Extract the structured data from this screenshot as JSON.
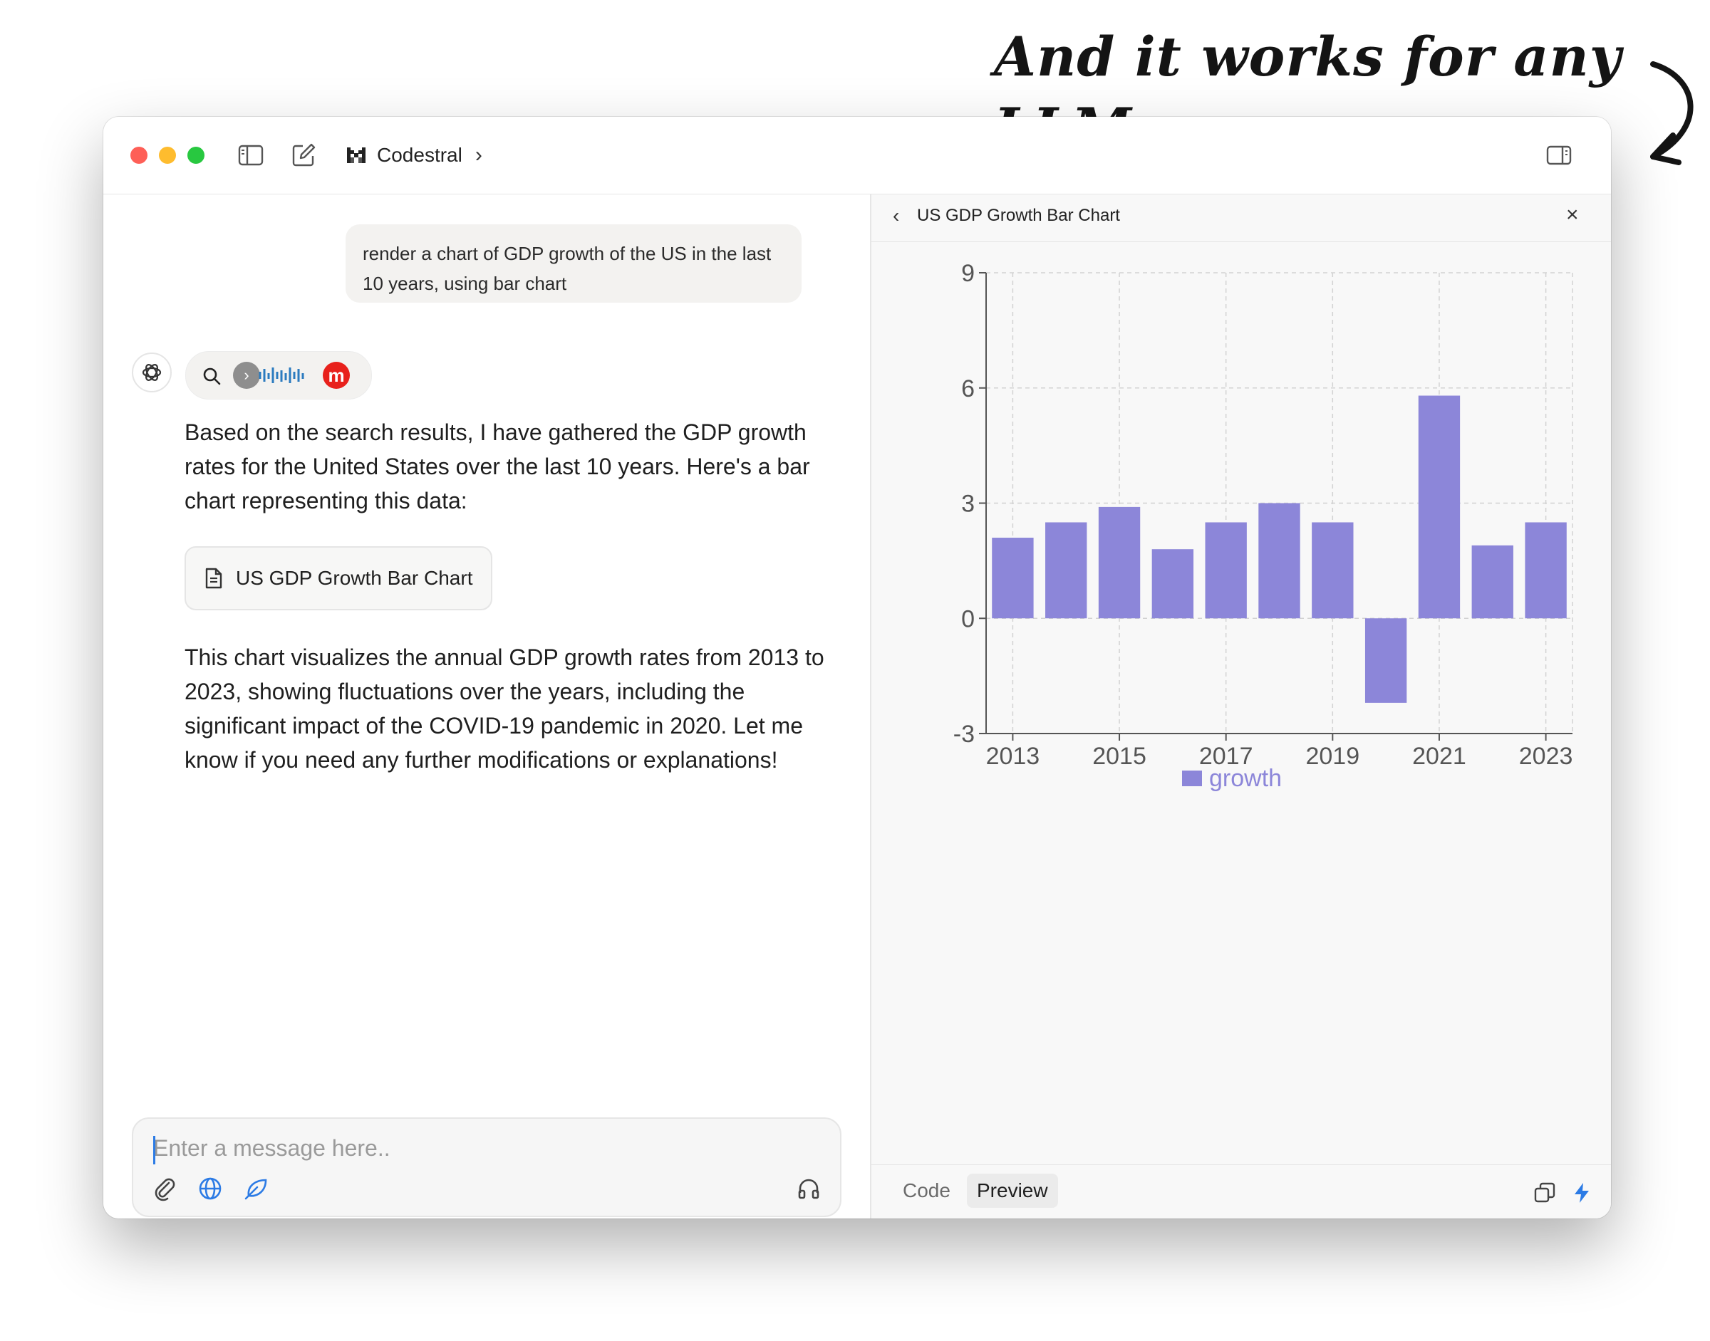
{
  "annotation": {
    "text": "And it works for any LLM"
  },
  "titlebar": {
    "model_name": "Codestral",
    "chevron": "›"
  },
  "chat": {
    "user_message": "render a chart of GDP growth of the US in the last 10 years, using bar chart",
    "assistant_intro": "Based on the search results, I have gathered the GDP growth rates for the United States over the last 10 years. Here's a bar chart representing this data:",
    "artifact_card_label": "US GDP Growth Bar Chart",
    "assistant_outro": "This chart visualizes the annual GDP growth rates from 2013 to 2023, showing fluctuations over the years, including the significant impact of the COVID-19 pandemic in 2020. Let me know if you need any further modifications or explanations!",
    "search_sources": [
      "chevron-source",
      "waveform-source",
      "m-source"
    ],
    "m_label": "m"
  },
  "composer": {
    "placeholder": "Enter a message here.."
  },
  "artifact": {
    "back_glyph": "‹",
    "title": "US GDP Growth Bar Chart",
    "close_glyph": "×",
    "tabs": {
      "code": "Code",
      "preview": "Preview"
    }
  },
  "colors": {
    "bar": "#8c86d9",
    "accent": "#2c7be5"
  },
  "chart_data": {
    "type": "bar",
    "categories": [
      "2013",
      "2014",
      "2015",
      "2016",
      "2017",
      "2018",
      "2019",
      "2020",
      "2021",
      "2022",
      "2023"
    ],
    "series": [
      {
        "name": "growth",
        "values": [
          2.1,
          2.5,
          2.9,
          1.8,
          2.5,
          3.0,
          2.5,
          -2.2,
          5.8,
          1.9,
          2.5
        ]
      }
    ],
    "xtick_labels": [
      "2013",
      "2015",
      "2017",
      "2019",
      "2021",
      "2023"
    ],
    "ylim": [
      -3,
      9
    ],
    "yticks": [
      -3,
      0,
      3,
      6,
      9
    ],
    "grid": true,
    "legend": "bottom",
    "title": "",
    "xlabel": "",
    "ylabel": ""
  }
}
